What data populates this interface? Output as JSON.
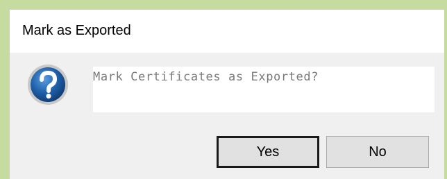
{
  "dialog": {
    "title": "Mark as Exported",
    "message": "Mark Certificates as Exported?",
    "icon": "question-icon"
  },
  "buttons": {
    "yes_label": "Yes",
    "no_label": "No"
  },
  "colors": {
    "window_border": "#c5dba0",
    "dialog_bg": "#f0f0f0",
    "icon_blue": "#1f5fa8",
    "message_text": "#7a7a7a"
  }
}
